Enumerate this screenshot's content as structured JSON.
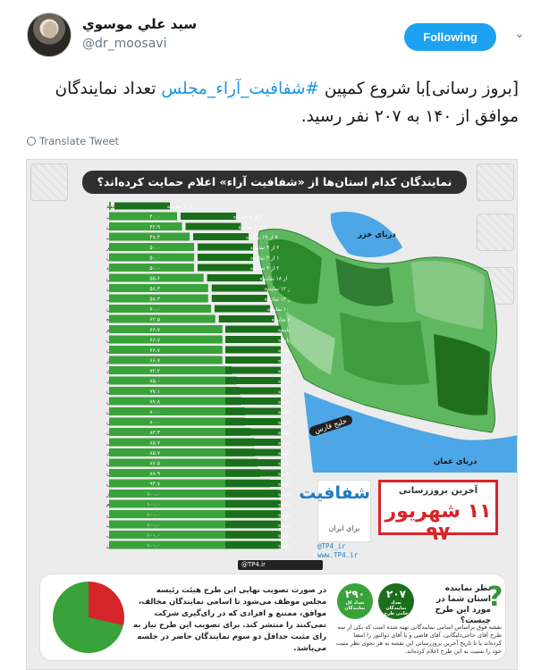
{
  "tweet": {
    "display_name": "سيد علي موسوي",
    "handle": "@dr_moosavi",
    "follow_label": "Following",
    "text_line1": "تعداد #شفافیت_آراء_مجلس [بروز رسانی]با شروع کمپین",
    "text_prefix": "[بروز رسانی]با شروع کمپین ",
    "hashtag": "#شفافیت_آراء_مجلس",
    "text_suffix": " تعداد نمایندگان موافق از ۱۴۰ به ۲۰۷ نفر رسید.",
    "translate_label": "Translate Tweet"
  },
  "infographic": {
    "title": "نمایندگان کدام استان‌ها از «شفافیت آراء» اعلام حمایت کرده‌اند؟",
    "sea_north": "دریای خزر",
    "sea_south_pill": "خلیج فارس",
    "sea_oman": "دریای عمان",
    "update_label": "آخرین بروزرسانی",
    "update_date": "۱۱ شهریور ۹۷",
    "logo_word": "شفافیت",
    "logo_sub": "برای ایران",
    "link1": "@TP4_ir",
    "link2": "www.TP4.ir",
    "social_handle": "@TP4.ir",
    "bottom_text": "در صورت تصویب نهایی این طرح هیئت رئیسه مجلس موظف می‌شود تا اسامی نمایندگان مخالف، موافق، ممتنع و افرادی که در رای‌گیری شرکت نمی‌کنند را منتشر کند. برای تصویب این طرح نیاز به رای مثبت حداقل دو سوم نمایندگان حاضر در جلسه می‌باشد.",
    "stat1_value": "۲۹۰",
    "stat1_label": "تعداد کل نمایندگان",
    "stat2_value": "۲۰۷",
    "stat2_label": "تعداد نمایندگان حامی طرح",
    "question": "نظر نماینده استان شما در مورد این طرح چیست؟",
    "note": "نقشه فوق براساس اسامی نمایندگانی تهیه شده است که یکی از سه طرح آقای حاجی‌دلیگانی، آقای قاضی و یا آقای ذوالنور را امضا کرده‌اند یا تا تاریخ آخرین بروزرسانی این نقشه به هر نحوی نظر مثبت خود را نسبت به این طرح اعلام کرده‌اند."
  },
  "chart_data": {
    "type": "bar",
    "categories": [
      "کهگیلویه و بویراحمد",
      "اقلیت های مذهبی",
      "گلستان",
      "آذربایجان شرقی",
      "بوشهر",
      "سمنان",
      "یزد",
      "فارس",
      "مازندران",
      "آذربایجان غربی",
      "کرمان",
      "کرمانشاه",
      "قم",
      "گیلان",
      "کردستان",
      "البرز",
      "خراسان رضوی",
      "چهارمحال و بختیاری",
      "تهران",
      "لرستان",
      "زنجان",
      "هرمزگان",
      "خوزستان",
      "اردبیل",
      "مرکزی",
      "سیستان و بلوچستان",
      "همدان",
      "اصفهان",
      "البرز",
      "ایلام",
      "قزوین",
      "خراسان جنوبی",
      "خراسان شمالی",
      "قزوین"
    ],
    "values": [
      0,
      40,
      42.9,
      47.4,
      50,
      50,
      50,
      55.6,
      58.3,
      58.3,
      60,
      62.5,
      66.7,
      66.7,
      66.7,
      66.7,
      72.2,
      75,
      77.1,
      77.8,
      80,
      80,
      83.3,
      85.7,
      85.7,
      87.5,
      88.9,
      94.7,
      100,
      100,
      100,
      100,
      100,
      100
    ],
    "value_labels": [
      "۰",
      "۴۰.۰",
      "۴۲.۹",
      "۴۷.۴",
      "۵۰.۰",
      "۵۰.۰",
      "۵۰.۰",
      "۵۵.۶",
      "۵۸.۳",
      "۵۸.۳",
      "۶۰.۰",
      "۶۲.۵",
      "۶۶.۷",
      "۶۶.۷",
      "۶۶.۷",
      "۶۶.۷",
      "۷۲.۲",
      "۷۵.۰",
      "۷۷.۱",
      "۷۷.۸",
      "۸۰.۰",
      "۸۰.۰",
      "۸۳.۳",
      "۸۵.۷",
      "۸۵.۷",
      "۸۷.۵",
      "۸۸.۹",
      "۹۴.۷",
      "۱۰۰.۰",
      "۱۰۰.۰",
      "۱۰۰.۰",
      "۱۰۰.۰",
      "۱۰۰.۰",
      "۱۰۰.۰"
    ],
    "ratio_labels": [
      "۰ از ۳ نماینده",
      "۲ از ۵ نماینده",
      "۳ از ۷ نماینده",
      "۹ از ۱۹ نماینده",
      "۲ از ۴ نماینده",
      "۱ از ۲ نماینده",
      "۲ از ۴ نماینده",
      "۱۰ از ۱۸ نماینده",
      "۷ از ۱۲ نماینده",
      "۷ از ۱۲ نماینده",
      "۶ از ۱۰ نماینده",
      "۵ از ۸ نماینده",
      "۲ از ۳ نماینده",
      "۸ از ۱۲ نماینده",
      "۴ از ۶ نماینده",
      "۲ از ۳ نماینده",
      "۱۳ از ۱۸ نماینده",
      "۳ از ۴ نماینده",
      "۲۷ از ۳۵ نماینده",
      "۷ از ۹ نماینده",
      "۴ از ۵ نماینده",
      "۴ از ۵ نماینده",
      "۱۵ از ۱۸ نماینده",
      "۶ از ۷ نماینده",
      "۶ از ۷ نماینده",
      "۷ از ۸ نماینده",
      "۸ از ۹ نماینده",
      "۱۸ از ۱۹ نماینده",
      "۳ از ۳ نماینده",
      "۳ از ۳ نماینده",
      "۳ از ۳ نماینده",
      "۴ از ۴ نماینده",
      "۴ از ۴ نماینده",
      "۴ از ۴ نماینده"
    ],
    "colors": {
      "bar": "#3aa23a",
      "dark": "#1b6e1b",
      "label_bg": "#1e1e1e",
      "accent": "#d6252a"
    },
    "xlim": [
      0,
      100
    ],
    "title": "نمایندگان کدام استان‌ها از «شفافیت آراء» اعلام حمایت کرده‌اند؟"
  },
  "pie": {
    "support_fraction": 0.714,
    "support_color": "#3aa23a",
    "other_color": "#d6252a"
  }
}
